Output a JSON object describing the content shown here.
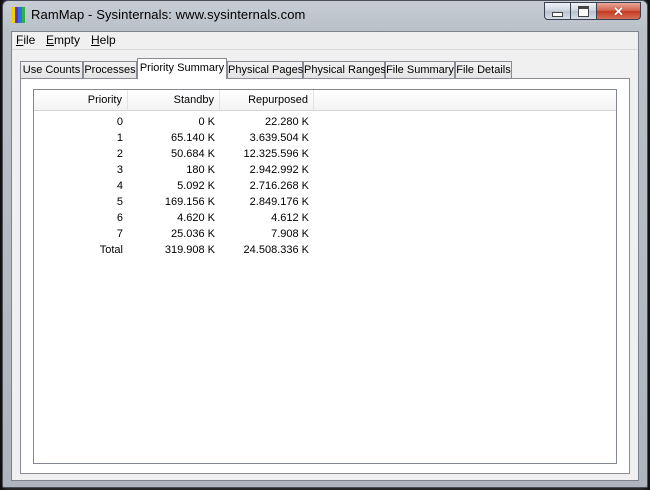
{
  "window": {
    "title": "RamMap - Sysinternals: www.sysinternals.com",
    "icon_colors": [
      "#f0d000",
      "#6a2fb5",
      "#2f6fe0",
      "#2fb04a"
    ]
  },
  "menu": [
    {
      "label": "File"
    },
    {
      "label": "Empty"
    },
    {
      "label": "Help"
    }
  ],
  "tabs": [
    {
      "label": "Use Counts",
      "active": false
    },
    {
      "label": "Processes",
      "active": false
    },
    {
      "label": "Priority Summary",
      "active": true
    },
    {
      "label": "Physical Pages",
      "active": false
    },
    {
      "label": "Physical Ranges",
      "active": false
    },
    {
      "label": "File Summary",
      "active": false
    },
    {
      "label": "File Details",
      "active": false
    }
  ],
  "table": {
    "columns": [
      "Priority",
      "Standby",
      "Repurposed"
    ],
    "rows": [
      [
        "0",
        "0 K",
        "22.280 K"
      ],
      [
        "1",
        "65.140 K",
        "3.639.504 K"
      ],
      [
        "2",
        "50.684 K",
        "12.325.596 K"
      ],
      [
        "3",
        "180 K",
        "2.942.992 K"
      ],
      [
        "4",
        "5.092 K",
        "2.716.268 K"
      ],
      [
        "5",
        "169.156 K",
        "2.849.176 K"
      ],
      [
        "6",
        "4.620 K",
        "4.612 K"
      ],
      [
        "7",
        "25.036 K",
        "7.908 K"
      ],
      [
        "Total",
        "319.908 K",
        "24.508.336 K"
      ]
    ]
  }
}
